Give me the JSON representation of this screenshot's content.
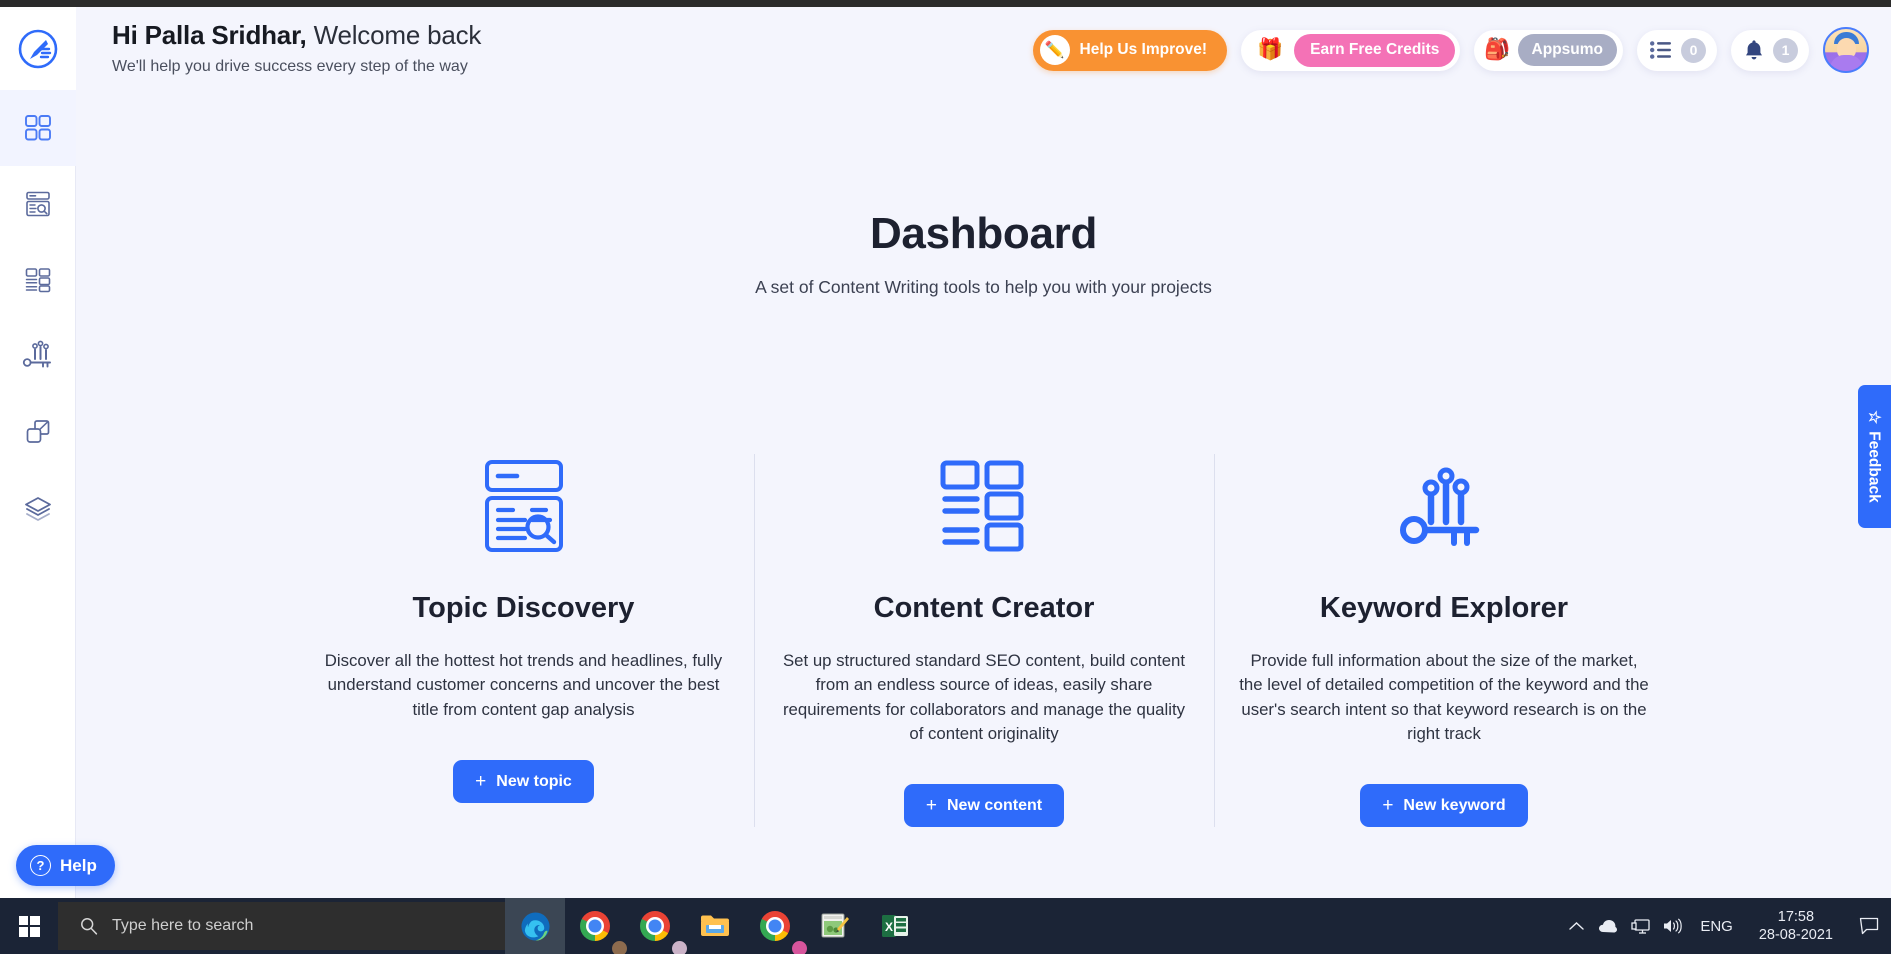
{
  "sidebar": {
    "logo_icon": "feather-pen-logo-icon",
    "items": [
      {
        "name": "dashboard",
        "icon": "grid-squares-icon",
        "active": true
      },
      {
        "name": "topic-discovery",
        "icon": "document-search-icon",
        "active": false
      },
      {
        "name": "content-creator",
        "icon": "layout-blocks-icon",
        "active": false
      },
      {
        "name": "keyword-explorer",
        "icon": "key-bars-icon",
        "active": false
      },
      {
        "name": "integrations",
        "icon": "overlap-squares-icon",
        "active": false
      },
      {
        "name": "layers",
        "icon": "layers-stack-icon",
        "active": false
      }
    ],
    "help_label": "Help",
    "help_icon": "question-circle-icon"
  },
  "header": {
    "greeting_name": "Hi Palla Sridhar,",
    "greeting_rest": " Welcome back",
    "subtitle": "We'll help you drive success every step of the way",
    "improve_label": "Help Us Improve!",
    "improve_icon": "pencil-icon",
    "credits_label": "Earn Free Credits",
    "credits_icon": "gift-icon",
    "plan_label": "Appsumo",
    "plan_icon": "backpack-icon",
    "tasks_count": "0",
    "tasks_icon": "list-icon",
    "notifications_count": "1",
    "notifications_icon": "bell-icon",
    "avatar_icon": "user-avatar"
  },
  "main": {
    "title": "Dashboard",
    "subtitle": "A set of Content Writing tools to help you with your projects",
    "cards": [
      {
        "icon": "document-search-icon",
        "title": "Topic Discovery",
        "description": "Discover all the hottest hot trends and headlines, fully understand customer concerns and uncover the best title from content gap analysis",
        "button_label": "New topic",
        "button_icon": "plus-icon"
      },
      {
        "icon": "layout-blocks-icon",
        "title": "Content Creator",
        "description": "Set up structured standard SEO content, build content from an endless source of ideas, easily share requirements for collaborators and manage the quality of content originality",
        "button_label": "New content",
        "button_icon": "plus-icon"
      },
      {
        "icon": "key-bars-icon",
        "title": "Keyword Explorer",
        "description": "Provide full information about the size of the market, the level of detailed competition of the keyword and the user's search intent so that keyword research is on the right track",
        "button_label": "New keyword",
        "button_icon": "plus-icon"
      }
    ]
  },
  "feedback": {
    "label": "Feedback",
    "icon": "star-icon"
  },
  "taskbar": {
    "start_icon": "windows-logo-icon",
    "search_placeholder": "Type here to search",
    "search_icon": "magnifier-icon",
    "apps": [
      {
        "name": "microsoft-edge",
        "icon": "edge-icon",
        "active": true
      },
      {
        "name": "chrome-profile-1",
        "icon": "chrome-icon",
        "active": false
      },
      {
        "name": "chrome-profile-2",
        "icon": "chrome-icon",
        "active": false
      },
      {
        "name": "file-explorer",
        "icon": "folder-icon",
        "active": false
      },
      {
        "name": "chrome-profile-3",
        "icon": "chrome-icon",
        "active": false
      },
      {
        "name": "paint",
        "icon": "paint-icon",
        "active": false
      },
      {
        "name": "excel",
        "icon": "excel-icon",
        "active": false
      }
    ],
    "tray": {
      "chevron_icon": "chevron-up-icon",
      "onedrive_icon": "cloud-icon",
      "network_icon": "monitor-icon",
      "volume_icon": "speaker-icon",
      "language": "ENG",
      "time": "17:58",
      "date": "28-08-2021",
      "action_center_icon": "speech-bubble-icon"
    }
  },
  "colors": {
    "accent_blue": "#2f6bfa",
    "page_bg": "#f4f5fd",
    "orange": "#f99232",
    "pink": "#f472b6",
    "sidebar_icon": "#5b6persist"
  }
}
